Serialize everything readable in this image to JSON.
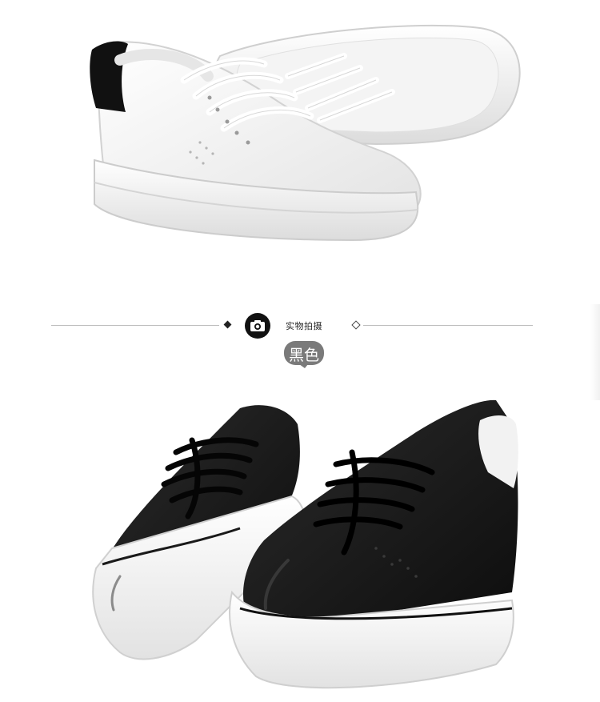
{
  "section": {
    "label": "实物拍摄",
    "color_name": "黑色"
  },
  "icons": {
    "section_icon": "camera-icon",
    "left_marker": "diamond-filled-icon",
    "right_marker": "diamond-outline-icon"
  },
  "colors": {
    "badge_background": "#7a7a7a",
    "divider_line": "#bdbdbd",
    "shoe_white": "#f7f7f7",
    "shoe_black": "#161616"
  }
}
